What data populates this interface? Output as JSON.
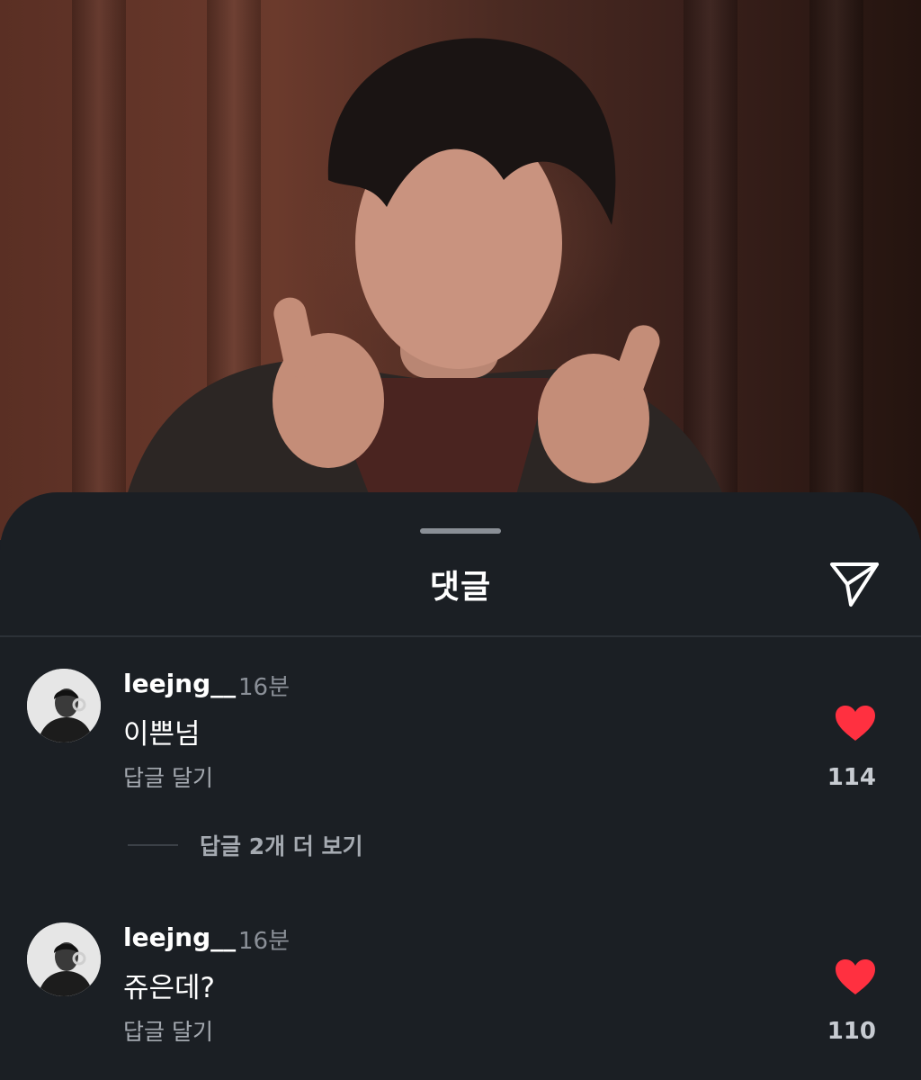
{
  "sheet": {
    "title": "댓글",
    "share_icon": "paper-plane-icon"
  },
  "comments": [
    {
      "username": "leejng__",
      "time": "16분",
      "text": "이쁜넘",
      "reply_label": "답글 달기",
      "like_count": "114",
      "liked": true,
      "view_replies_label": "답글 2개 더 보기"
    },
    {
      "username": "leejng__",
      "time": "16분",
      "text": "쥬은데?",
      "reply_label": "답글 달기",
      "like_count": "110",
      "liked": true
    }
  ],
  "colors": {
    "sheet_bg": "#1b1f24",
    "heart": "#ff3040",
    "text_primary": "#ffffff",
    "text_secondary": "#8b9098"
  }
}
